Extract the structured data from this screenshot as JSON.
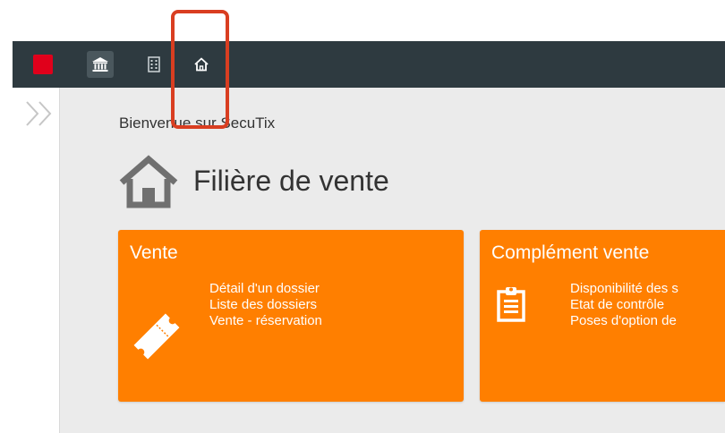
{
  "header": {
    "icons": [
      "app-logo-icon",
      "bank-icon",
      "building-icon",
      "home-icon"
    ]
  },
  "sidebar": {
    "expand_icon": "double-chevron-right-icon"
  },
  "main": {
    "welcome": "Bienvenue sur SecuTix",
    "page_title": "Filière de vente",
    "cards": [
      {
        "title": "Vente",
        "icon": "ticket-icon",
        "links": [
          "Détail d'un dossier",
          "Liste des dossiers",
          "Vente - réservation"
        ]
      },
      {
        "title": "Complément vente",
        "icon": "clipboard-icon",
        "links": [
          "Disponibilité des s",
          "Etat de contrôle",
          "Poses d'option de"
        ]
      }
    ]
  },
  "colors": {
    "topbar": "#2e3a40",
    "brand_red": "#e0001b",
    "card_orange": "#ff7f00",
    "highlight": "#d93e21",
    "content_bg": "#ebebeb"
  }
}
